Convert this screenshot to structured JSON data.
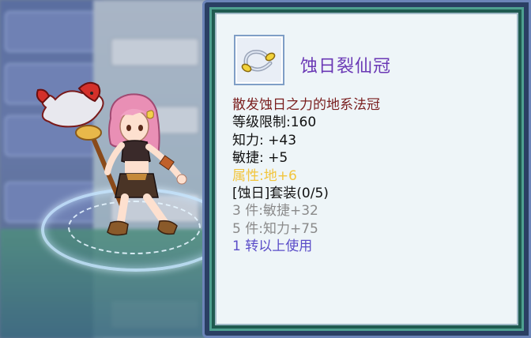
{
  "tooltip": {
    "item_name": "蚀日裂仙冠",
    "item_icon": "headband-icon",
    "description": "散发蚀日之力的地系法冠",
    "level_req": "等级限制:160",
    "int_stat": "知力: +43",
    "agi_stat": "敏捷: +5",
    "attribute": "属性:地+6",
    "set_title": "[蚀日]套装(0/5)",
    "set_bonus_3": "3 件:敏捷+32",
    "set_bonus_5": "5 件:知力+75",
    "class_req": "1 转以上使用"
  },
  "colors": {
    "name": "#6a38b5",
    "description": "#7a1e1e",
    "stat": "#111111",
    "attribute": "#f2c53d",
    "set_inactive": "#8a8a8a",
    "class_req": "#5b4dc8",
    "panel_frame": "#2a3f63",
    "panel_inner": "#eef5f8"
  }
}
